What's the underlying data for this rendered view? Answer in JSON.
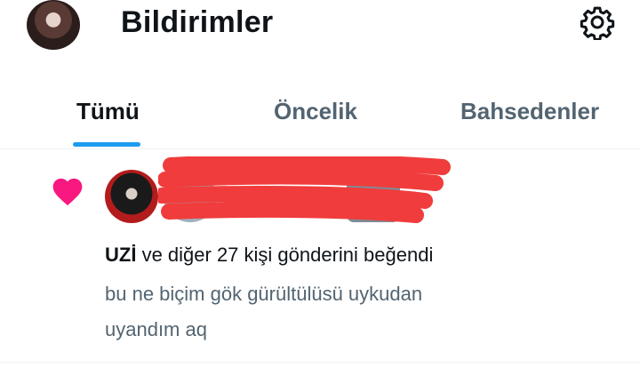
{
  "header": {
    "title": "Bildirimler",
    "settings_icon": "gear-icon"
  },
  "tabs": [
    {
      "label": "Tümü",
      "active": true
    },
    {
      "label": "Öncelik",
      "active": false
    },
    {
      "label": "Bahsedenler",
      "active": false
    }
  ],
  "notification": {
    "icon": "heart-icon",
    "icon_color": "#f91880",
    "user": "UZİ",
    "action_text": " ve diğer 27 kişi gönderini beğendi",
    "post_preview_line1": "bu ne biçim gök gürültülüsü uykudan",
    "post_preview_line2": "uyandım aq"
  },
  "colors": {
    "accent": "#1d9bf0",
    "text": "#0f1419",
    "muted": "#536471",
    "redaction": "#f03c3c"
  }
}
